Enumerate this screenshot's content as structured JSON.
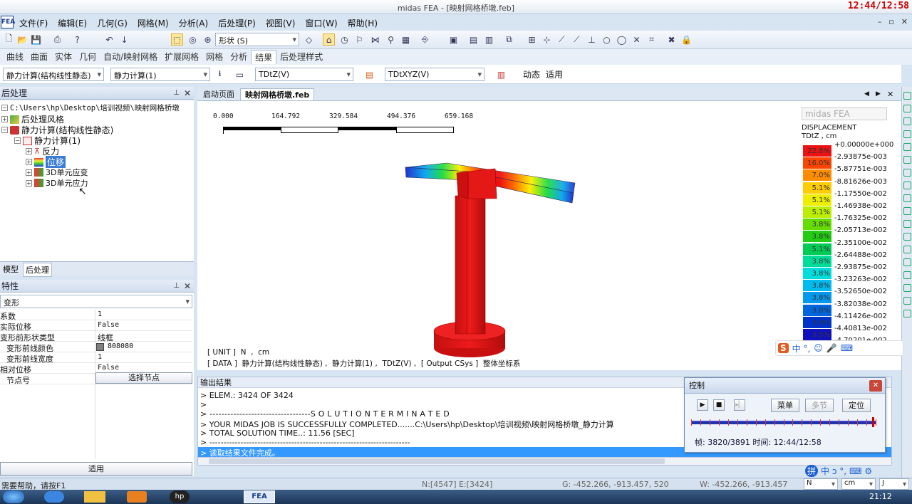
{
  "app": {
    "title": "midas FEA - [映射网格桥墩.feb]",
    "icon": "FEA",
    "timer": "12:44/12:58"
  },
  "menu": [
    "文件(F)",
    "编辑(E)",
    "几何(G)",
    "网格(M)",
    "分析(A)",
    "后处理(P)",
    "视图(V)",
    "窗口(W)",
    "帮助(H)"
  ],
  "toolbar": {
    "shape_combo": "形状 (S)"
  },
  "ribbon_tabs": [
    "曲线",
    "曲面",
    "实体",
    "几何",
    "自动/映射网格",
    "扩展网格",
    "网格",
    "分析",
    "结果",
    "后处理样式"
  ],
  "ribbon_active": 8,
  "results_bar": {
    "analysis_case": "静力计算(结构线性静态)",
    "load_step": "静力计算(1)",
    "component1": "TDtZ(V)",
    "component2": "TDtXYZ(V)",
    "dynamic": "动态",
    "apply": "适用"
  },
  "post_panel": {
    "title": "后处理",
    "tree": [
      {
        "label": "C:\\Users\\hp\\Desktop\\培训视频\\映射网格桥墩"
      },
      {
        "label": "后处理风格"
      },
      {
        "label": "静力计算(结构线性静态)"
      },
      {
        "label": "静力计算(1)"
      },
      {
        "label": "反力"
      },
      {
        "label": "位移"
      },
      {
        "label": "3D单元应变"
      },
      {
        "label": "3D单元应力"
      }
    ],
    "tabs": [
      "模型",
      "后处理"
    ]
  },
  "props_panel": {
    "title": "特性",
    "selector": "变形",
    "rows": [
      {
        "k": "系数",
        "v": "1"
      },
      {
        "k": "实际位移",
        "v": "False"
      },
      {
        "k": "变形前形状类型",
        "v": "线框"
      },
      {
        "k": "变形前线颜色",
        "v": "808080"
      },
      {
        "k": "变形前线宽度",
        "v": "1"
      },
      {
        "k": "相对位移",
        "v": "False"
      },
      {
        "k": "节点号",
        "v": "选择节点"
      }
    ],
    "apply": "适用"
  },
  "doc_tabs": [
    "启动页面",
    "映射网格桥墩.feb"
  ],
  "viewport": {
    "scale_labels": [
      "0.000",
      "164.792",
      "329.584",
      "494.376",
      "659.168"
    ],
    "brand": "midas FEA",
    "legend_title": "DISPLACEMENT",
    "legend_sub": "TDtZ , cm",
    "legend_values": [
      "+0.00000e+000",
      "-2.93875e-003",
      "-5.87751e-003",
      "-8.81626e-003",
      "-1.17550e-002",
      "-1.46938e-002",
      "-1.76325e-002",
      "-2.05713e-002",
      "-2.35100e-002",
      "-2.64488e-002",
      "-2.93875e-002",
      "-3.23263e-002",
      "-3.52650e-002",
      "-3.82038e-002",
      "-4.11426e-002",
      "-4.40813e-002",
      "-4.70201e-002"
    ],
    "legend_pcts": [
      "22.8%",
      "16.0%",
      "7.0%",
      "5.1%",
      "5.1%",
      "5.1%",
      "3.8%",
      "3.8%",
      "5.1%",
      "3.8%",
      "3.8%",
      "3.8%",
      "3.8%",
      "3.8%",
      "3.8%",
      "3.5%"
    ],
    "legend_colors": [
      "#ee1111",
      "#ff4400",
      "#ff8c00",
      "#ffcc00",
      "#eeee00",
      "#bbee00",
      "#66dd00",
      "#22cc11",
      "#00cc55",
      "#00dd99",
      "#00dddd",
      "#00bbee",
      "#0099ee",
      "#0066dd",
      "#0033cc",
      "#1111bb"
    ],
    "unit_line": "[ UNIT ]  N  ,  cm",
    "data_line": "[ DATA ]  静力计算(结构线性静态) ,  静力计算(1) ,  TDtZ(V) ,  [ Output CSys ]  整体坐标系"
  },
  "output": {
    "title": "输出结果",
    "lines": [
      ">  ELEM.:  3424 OF   3424",
      ">",
      "> ----------------------------------S O L U T I O N   T E R M I N A T E D",
      "> YOUR MIDAS JOB IS SUCCESSFULLY COMPLETED.......C:\\Users\\hp\\Desktop\\培训视频\\映射网格桥墩_静力计算",
      "> TOTAL SOLUTION TIME..:   11.56 [SEC]",
      "> -----------------------------------------------------------------------"
    ],
    "highlight": "> 读取结果文件完成。"
  },
  "control": {
    "title": "控制",
    "menu_btn": "菜单",
    "step_btn": "多节",
    "locate_btn": "定位",
    "frame_label": "帧: 3820/3891 时间: 12:44/12:58",
    "progress": 0.98
  },
  "status": {
    "help": "需要帮助，请按F1",
    "nodes": "N:[4547] E:[3424]",
    "g": "G: -452.266, -913.457, 520",
    "w": "W: -452.266, -913.457",
    "unit1": "N",
    "unit2": "cm",
    "unit3": "J"
  },
  "taskbar": {
    "clock": "21:12"
  }
}
